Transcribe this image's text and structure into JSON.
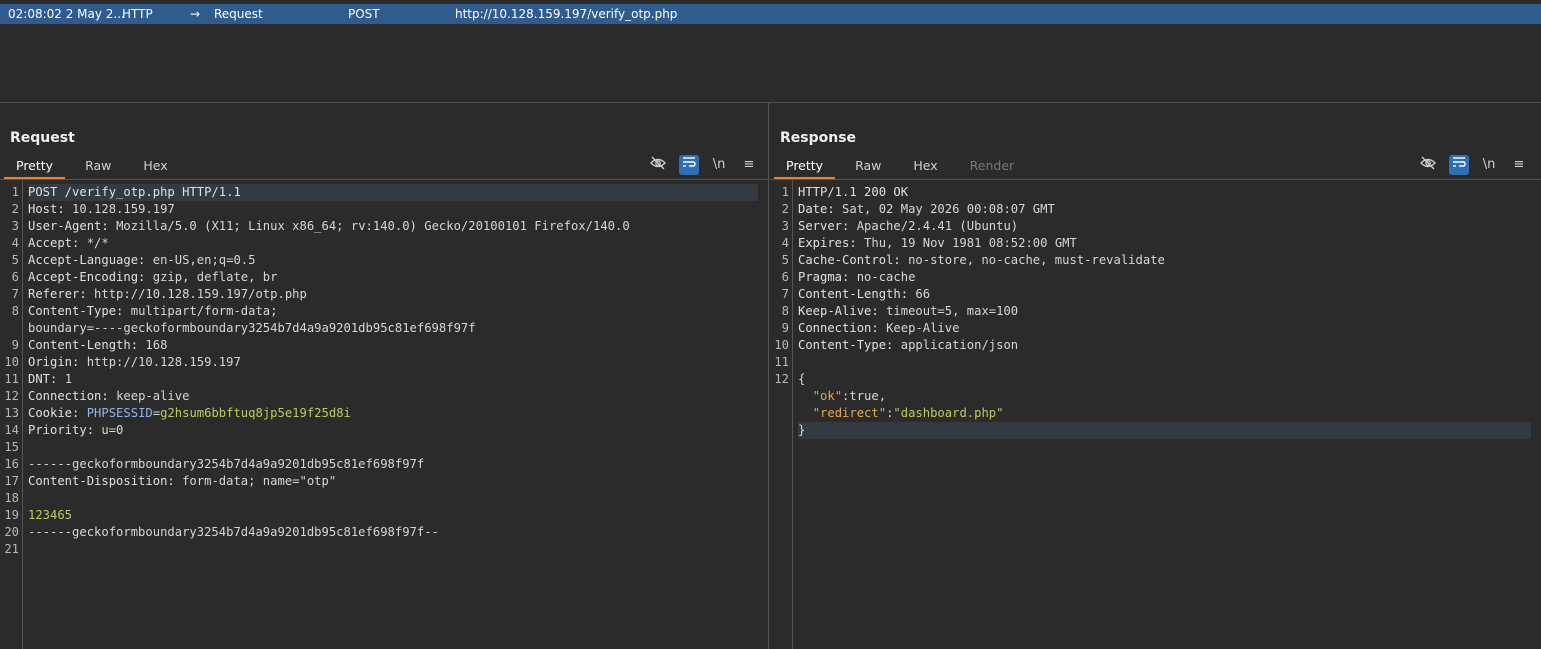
{
  "history": {
    "time": "02:08:02 2 May 2...",
    "tool": "HTTP",
    "direction_icon": "arrow-right-icon",
    "type": "Request",
    "method": "POST",
    "url": "http://10.128.159.197/verify_otp.php"
  },
  "request": {
    "title": "Request",
    "tabs": [
      "Pretty",
      "Raw",
      "Hex"
    ],
    "lines": [
      {
        "n": "1",
        "parts": [
          [
            "POST /verify_otp.php HTTP/1.1",
            "k"
          ]
        ],
        "hl": true
      },
      {
        "n": "2",
        "parts": [
          [
            "Host: ",
            "k"
          ],
          [
            "10.128.159.197",
            ""
          ]
        ]
      },
      {
        "n": "3",
        "parts": [
          [
            "User-Agent: ",
            "k"
          ],
          [
            "Mozilla/5.0 (X11; Linux x86_64; rv:140.0) Gecko/20100101 Firefox/140.0",
            ""
          ]
        ]
      },
      {
        "n": "4",
        "parts": [
          [
            "Accept: ",
            "k"
          ],
          [
            "*/*",
            ""
          ]
        ]
      },
      {
        "n": "5",
        "parts": [
          [
            "Accept-Language: ",
            "k"
          ],
          [
            "en-US,en;q=0.5",
            ""
          ]
        ]
      },
      {
        "n": "6",
        "parts": [
          [
            "Accept-Encoding: ",
            "k"
          ],
          [
            "gzip, deflate, br",
            ""
          ]
        ]
      },
      {
        "n": "7",
        "parts": [
          [
            "Referer: ",
            "k"
          ],
          [
            "http://10.128.159.197/otp.php",
            ""
          ]
        ]
      },
      {
        "n": "8",
        "parts": [
          [
            "Content-Type: ",
            "k"
          ],
          [
            "multipart/form-data;",
            ""
          ]
        ]
      },
      {
        "n": "",
        "parts": [
          [
            "boundary=----geckoformboundary3254b7d4a9a9201db95c81ef698f97f",
            ""
          ]
        ]
      },
      {
        "n": "9",
        "parts": [
          [
            "Content-Length: ",
            "k"
          ],
          [
            "168",
            ""
          ]
        ]
      },
      {
        "n": "10",
        "parts": [
          [
            "Origin: ",
            "k"
          ],
          [
            "http://10.128.159.197",
            ""
          ]
        ]
      },
      {
        "n": "11",
        "parts": [
          [
            "DNT: ",
            "k"
          ],
          [
            "1",
            ""
          ]
        ]
      },
      {
        "n": "12",
        "parts": [
          [
            "Connection: ",
            "k"
          ],
          [
            "keep-alive",
            ""
          ]
        ]
      },
      {
        "n": "13",
        "parts": [
          [
            "Cookie: ",
            "k"
          ],
          [
            "PHPSESSID",
            "b"
          ],
          [
            "=",
            ""
          ],
          [
            "g2hsum6bbftuq8jp5e19f25d8i",
            "g"
          ]
        ]
      },
      {
        "n": "14",
        "parts": [
          [
            "Priority: ",
            "k"
          ],
          [
            "u=0",
            ""
          ]
        ]
      },
      {
        "n": "15",
        "parts": [
          [
            "",
            ""
          ]
        ]
      },
      {
        "n": "16",
        "parts": [
          [
            "------geckoformboundary3254b7d4a9a9201db95c81ef698f97f",
            ""
          ]
        ]
      },
      {
        "n": "17",
        "parts": [
          [
            "Content-Disposition: ",
            "k"
          ],
          [
            "form-data; name=\"otp\"",
            ""
          ]
        ]
      },
      {
        "n": "18",
        "parts": [
          [
            "",
            ""
          ]
        ]
      },
      {
        "n": "19",
        "parts": [
          [
            "123465",
            "g"
          ]
        ]
      },
      {
        "n": "20",
        "parts": [
          [
            "------geckoformboundary3254b7d4a9a9201db95c81ef698f97f--",
            ""
          ]
        ]
      },
      {
        "n": "21",
        "parts": [
          [
            "",
            ""
          ]
        ]
      }
    ]
  },
  "response": {
    "title": "Response",
    "tabs": [
      "Pretty",
      "Raw",
      "Hex",
      "Render"
    ],
    "lines": [
      {
        "n": "1",
        "parts": [
          [
            "HTTP/1.1 200 OK",
            "k"
          ]
        ]
      },
      {
        "n": "2",
        "parts": [
          [
            "Date: ",
            "k"
          ],
          [
            "Sat, 02 May 2026 00:08:07 GMT",
            ""
          ]
        ]
      },
      {
        "n": "3",
        "parts": [
          [
            "Server: ",
            "k"
          ],
          [
            "Apache/2.4.41 (Ubuntu)",
            ""
          ]
        ]
      },
      {
        "n": "4",
        "parts": [
          [
            "Expires: ",
            "k"
          ],
          [
            "Thu, 19 Nov 1981 08:52:00 GMT",
            ""
          ]
        ]
      },
      {
        "n": "5",
        "parts": [
          [
            "Cache-Control: ",
            "k"
          ],
          [
            "no-store, no-cache, must-revalidate",
            ""
          ]
        ]
      },
      {
        "n": "6",
        "parts": [
          [
            "Pragma: ",
            "k"
          ],
          [
            "no-cache",
            ""
          ]
        ]
      },
      {
        "n": "7",
        "parts": [
          [
            "Content-Length: ",
            "k"
          ],
          [
            "66",
            ""
          ]
        ]
      },
      {
        "n": "8",
        "parts": [
          [
            "Keep-Alive: ",
            "k"
          ],
          [
            "timeout=5, max=100",
            ""
          ]
        ]
      },
      {
        "n": "9",
        "parts": [
          [
            "Connection: ",
            "k"
          ],
          [
            "Keep-Alive",
            ""
          ]
        ]
      },
      {
        "n": "10",
        "parts": [
          [
            "Content-Type: ",
            "k"
          ],
          [
            "application/json",
            ""
          ]
        ]
      },
      {
        "n": "11",
        "parts": [
          [
            "",
            ""
          ]
        ]
      },
      {
        "n": "12",
        "parts": [
          [
            "{",
            ""
          ]
        ]
      },
      {
        "n": "",
        "parts": [
          [
            "  ",
            ""
          ],
          [
            "\"ok\"",
            "o"
          ],
          [
            ":true,",
            ""
          ]
        ]
      },
      {
        "n": "",
        "parts": [
          [
            "  ",
            ""
          ],
          [
            "\"redirect\"",
            "o"
          ],
          [
            ":",
            ""
          ],
          [
            "\"dashboard.php\"",
            "g"
          ]
        ]
      },
      {
        "n": "",
        "parts": [
          [
            "}",
            ""
          ]
        ],
        "hl": true
      }
    ]
  },
  "toolbar": {
    "hide_icon": "eye-slash-icon",
    "wrap_icon": "word-wrap-icon",
    "newline_label": "\\n",
    "menu_icon": "hamburger-menu-icon"
  },
  "colors": {
    "accent_tab": "#e8812e",
    "selected_row": "#2f5c8f",
    "value_green": "#b5cf5a",
    "json_key": "#e6a84b"
  }
}
